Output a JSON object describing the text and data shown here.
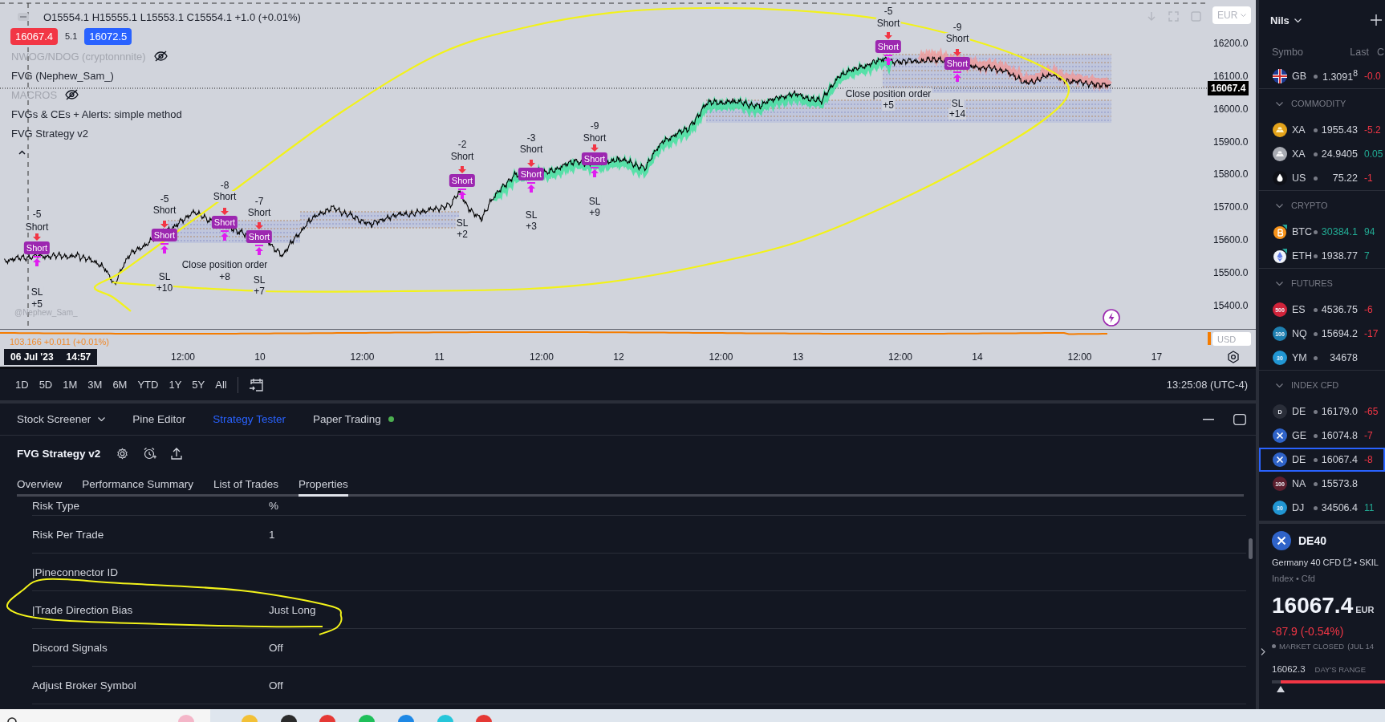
{
  "chart": {
    "ohlc": "O15554.1 H15555.1 L15553.1 C15554.1 +1.0 (+0.01%)",
    "sell_price": "16067.4",
    "spread": "5.1",
    "buy_price": "16072.5",
    "indicators": [
      {
        "name": "NWOG/NDOG (cryptonnnite)",
        "hidden": true
      },
      {
        "name": "FVG (Nephew_Sam_)",
        "hidden": false
      },
      {
        "name": "MACROS",
        "hidden": true
      },
      {
        "name": "FVGs & CEs + Alerts: simple method",
        "hidden": false
      },
      {
        "name": "FVG Strategy v2",
        "hidden": false
      }
    ],
    "trades": [
      {
        "size": "-5",
        "signal": "Short",
        "badge": "Short",
        "exit": "SL",
        "result": "+5"
      },
      {
        "size": "-5",
        "signal": "Short",
        "badge": "Short",
        "exit": "SL",
        "result": "+10"
      },
      {
        "size": "-8",
        "signal": "Short",
        "badge": "Short",
        "exit": "Close position order",
        "result": "+8"
      },
      {
        "size": "-7",
        "signal": "Short",
        "badge": "Short",
        "exit": "SL",
        "result": "+7"
      },
      {
        "size": "-2",
        "signal": "Short",
        "badge": "Short",
        "exit": "SL",
        "result": "+2"
      },
      {
        "size": "-3",
        "signal": "Short",
        "badge": "Short",
        "exit": "SL",
        "result": "+3"
      },
      {
        "size": "-9",
        "signal": "Short",
        "badge": "Short",
        "exit": "SL",
        "result": "+9"
      },
      {
        "size": "-5",
        "signal": "Short",
        "badge": "Short",
        "exit": "Close position order",
        "result": "+5"
      },
      {
        "size": "-9",
        "signal": "Short",
        "badge": "Short",
        "exit": "SL",
        "result": "+14"
      }
    ],
    "signature": "@Nephew_Sam_",
    "currency": "EUR",
    "price_axis": [
      "16200.0",
      "16100.0",
      "16000.0",
      "15900.0",
      "15800.0",
      "15700.0",
      "15600.0",
      "15500.0",
      "15400.0"
    ],
    "last_price": "16067.4",
    "sub_pane": {
      "legend": "103.166 +0.011 (+0.01%)",
      "currency": "USD"
    },
    "crosshair": {
      "date": "06 Jul '23",
      "time": "14:57"
    },
    "time_axis": [
      "12:00",
      "10",
      "12:00",
      "11",
      "12:00",
      "12",
      "12:00",
      "13",
      "12:00",
      "14",
      "12:00",
      "17"
    ]
  },
  "range_bar": {
    "ranges": [
      "1D",
      "5D",
      "1M",
      "3M",
      "6M",
      "YTD",
      "1Y",
      "5Y",
      "All"
    ],
    "clock": "13:25:08 (UTC-4)"
  },
  "bottom_panel": {
    "tabs": [
      {
        "label": "Stock Screener",
        "kind": "dropdown",
        "selected": false
      },
      {
        "label": "Pine Editor",
        "kind": "plain",
        "selected": false
      },
      {
        "label": "Strategy Tester",
        "kind": "plain",
        "selected": true
      },
      {
        "label": "Paper Trading",
        "kind": "live",
        "selected": false
      }
    ],
    "strategy": "FVG Strategy v2",
    "subtabs": [
      {
        "label": "Overview",
        "selected": false
      },
      {
        "label": "Performance Summary",
        "selected": false
      },
      {
        "label": "List of Trades",
        "selected": false
      },
      {
        "label": "Properties",
        "selected": true
      }
    ],
    "properties": [
      {
        "label": "Risk Type",
        "value": "%"
      },
      {
        "label": "Risk Per Trade",
        "value": "1"
      },
      {
        "label": "|Pineconnector ID"
      },
      {
        "label": "|Trade Direction Bias",
        "value": "Just Long"
      },
      {
        "label": "Discord Signals",
        "value": "Off"
      },
      {
        "label": "Adjust Broker Symbol",
        "value": "Off"
      }
    ]
  },
  "watchlist": {
    "owner": "Nils",
    "columns": [
      "Symbo",
      "Last",
      "C"
    ],
    "rows": [
      {
        "kind": "symbol",
        "logo": {
          "kind": "flag"
        },
        "symbol": "GB",
        "last": "1.3091$^{8}$",
        "last_rising": false,
        "change": {
          "text": "-0.0",
          "falling": true
        },
        "selected": false
      },
      {
        "kind": "section",
        "title": "COMMODITY",
        "expanded": true
      },
      {
        "kind": "symbol",
        "logo": {
          "kind": "gold"
        },
        "symbol": "XA",
        "last": "1955.43",
        "last_rising": false,
        "change": {
          "text": "-5.2",
          "falling": true
        },
        "selected": false
      },
      {
        "kind": "symbol",
        "logo": {
          "kind": "silver"
        },
        "symbol": "XA",
        "last": "24.9405",
        "last_rising": false,
        "change": {
          "text": "0.05",
          "falling": false
        },
        "selected": false
      },
      {
        "kind": "symbol",
        "logo": {
          "kind": "drop"
        },
        "symbol": "US",
        "last": "75.22",
        "last_rising": false,
        "change": {
          "text": "-1",
          "falling": true
        },
        "selected": false
      },
      {
        "kind": "section",
        "title": "CRYPTO",
        "expanded": true
      },
      {
        "kind": "symbol",
        "logo": {
          "kind": "bitcoin"
        },
        "symbol": "BTC",
        "last": "30384.1",
        "last_rising": true,
        "change": {
          "text": "94",
          "falling": false
        },
        "selected": false
      },
      {
        "kind": "symbol",
        "logo": {
          "kind": "ether"
        },
        "symbol": "ETH",
        "last": "1938.77",
        "last_rising": false,
        "change": {
          "text": "7",
          "falling": false
        },
        "selected": false
      },
      {
        "kind": "section",
        "title": "FUTURES",
        "expanded": true
      },
      {
        "kind": "symbol",
        "logo": {
          "kind": "badge",
          "text": "500",
          "color": "#d0233a"
        },
        "symbol": "ES",
        "last": "4536.75",
        "last_rising": false,
        "change": {
          "text": "-6",
          "falling": true
        },
        "selected": false
      },
      {
        "kind": "symbol",
        "logo": {
          "kind": "badge",
          "text": "100",
          "color": "#1e7fb0"
        },
        "symbol": "NQ",
        "last": "15694.2",
        "last_rising": false,
        "change": {
          "text": "-17",
          "falling": true
        },
        "selected": false
      },
      {
        "kind": "symbol",
        "logo": {
          "kind": "badge",
          "text": "30",
          "color": "#2196d3"
        },
        "symbol": "YM",
        "last": "34678",
        "last_rising": false,
        "selected": false
      },
      {
        "kind": "section",
        "title": "INDEX CFD",
        "expanded": true
      },
      {
        "kind": "symbol",
        "logo": {
          "kind": "badge",
          "text": "D",
          "color": "#2a2e39"
        },
        "symbol": "DE",
        "last": "16179.0",
        "last_rising": false,
        "change": {
          "text": "-65",
          "falling": true
        },
        "selected": false
      },
      {
        "kind": "symbol",
        "logo": {
          "kind": "cross"
        },
        "symbol": "GE",
        "last": "16074.8",
        "last_rising": false,
        "change": {
          "text": "-7",
          "falling": true
        },
        "selected": false
      },
      {
        "kind": "symbol",
        "logo": {
          "kind": "cross"
        },
        "symbol": "DE",
        "last": "16067.4",
        "last_rising": false,
        "change": {
          "text": "-8",
          "falling": true
        },
        "selected": true
      },
      {
        "kind": "symbol",
        "logo": {
          "kind": "badge",
          "text": "100",
          "color": "#5c1f2e"
        },
        "symbol": "NA",
        "last": "15573.8",
        "last_rising": false,
        "selected": false
      },
      {
        "kind": "symbol",
        "logo": {
          "kind": "badge",
          "text": "30",
          "color": "#2196d3"
        },
        "symbol": "DJ",
        "last": "34506.4",
        "last_rising": false,
        "change": {
          "text": "11",
          "falling": false
        },
        "selected": false
      }
    ]
  },
  "symbol_details": {
    "symbol": "DE40",
    "name": "Germany 40 CFD",
    "exchange": "• SKIL",
    "classification": "Index • Cfd",
    "price": "16067.4",
    "currency": "EUR",
    "change": "-87.9 (-0.54%)",
    "status": "MARKET CLOSED",
    "status_note": "(JUL 14",
    "day_range": {
      "low": "16062.3",
      "label": "DAY'S RANGE",
      "level": 0.08
    }
  }
}
